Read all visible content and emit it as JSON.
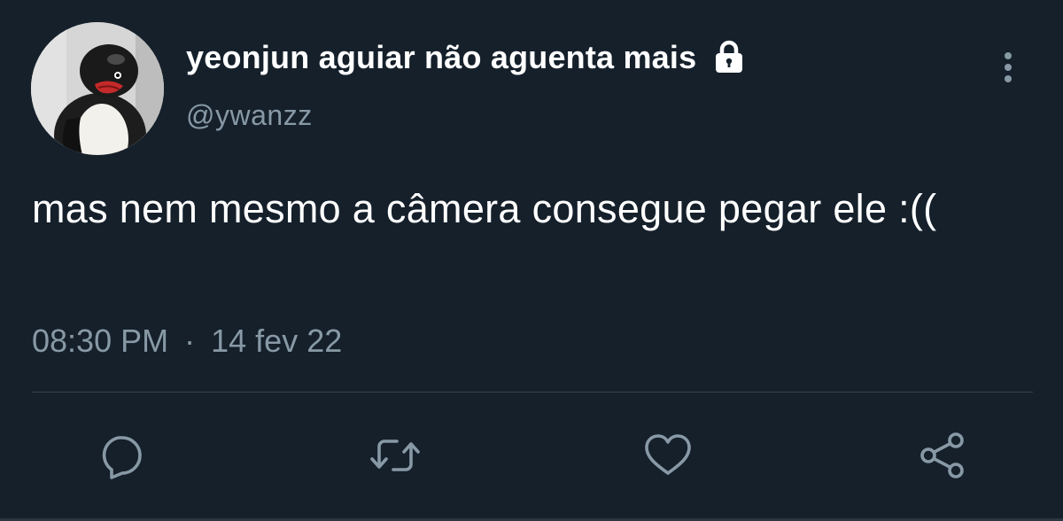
{
  "user": {
    "display_name": "yeonjun aguiar não aguenta mais",
    "handle": "@ywanzz",
    "avatar_icon": "penguin-avatar",
    "protected_icon": "lock-icon"
  },
  "tweet": {
    "text": "mas nem mesmo a câmera consegue pegar ele :((",
    "time": "08:30 PM",
    "separator": "·",
    "date": "14 fev 22"
  },
  "actions": {
    "reply_icon": "reply-icon",
    "retweet_icon": "retweet-icon",
    "like_icon": "heart-icon",
    "share_icon": "share-icon",
    "more_icon": "more-options-icon"
  },
  "colors": {
    "background": "#15202b",
    "primary_text": "#ffffff",
    "secondary_text": "#8899a6",
    "divider": "#38444d"
  }
}
